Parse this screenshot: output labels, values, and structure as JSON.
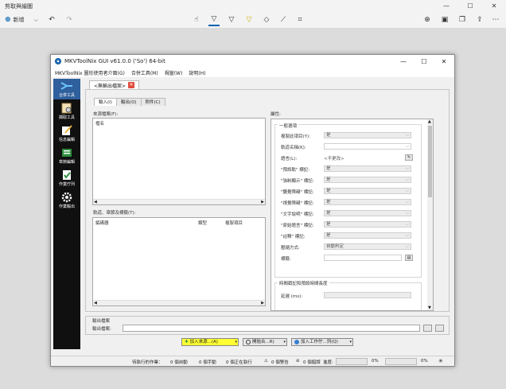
{
  "snip": {
    "title": "剪取與繪圖",
    "new_label": "新增",
    "window_controls": [
      "minimize-icon",
      "maximize-icon",
      "close-icon"
    ],
    "toolbar_icons": [
      "undo-icon",
      "redo-icon",
      "touch-writing-icon",
      "ballpoint-pen-icon",
      "pencil-icon",
      "highlighter-icon",
      "eraser-icon",
      "ruler-icon",
      "crop-icon",
      "zoom-icon",
      "save-icon",
      "copy-icon",
      "share-icon",
      "more-icon"
    ]
  },
  "mkv": {
    "title": "MKVToolNix GUI v61.0.0 ('So') 64-bit",
    "menu": [
      "MKVToolNix 圖形使用者介面(G)",
      "合併工具(M)",
      "視窗(W)",
      "說明(H)"
    ],
    "sidebar": [
      {
        "label": "合併工具",
        "icon": "merge-icon",
        "active": true
      },
      {
        "label": "擷取工具",
        "icon": "extract-icon",
        "active": false
      },
      {
        "label": "信息編輯",
        "icon": "info-editor-icon",
        "active": false
      },
      {
        "label": "章節編輯",
        "icon": "chapter-editor-icon",
        "active": false
      },
      {
        "label": "作業佇列",
        "icon": "job-queue-icon",
        "active": false
      },
      {
        "label": "作業輸出",
        "icon": "job-output-icon",
        "active": false
      }
    ],
    "outer_tab": "<無輸出檔案>",
    "sub_tabs": [
      "輸入(I)",
      "輸出(O)",
      "附件(C)"
    ],
    "source_files_label": "來源檔案(F):",
    "source_col_name": "檔名",
    "tracks_label": "軌道、章節及標籤(T):",
    "tracks_cols": [
      "編碼器",
      "類型",
      "複製項目"
    ],
    "properties_label": "屬性:",
    "general_group": "一般選項",
    "props": [
      {
        "label": "複製此項目(Y):",
        "value": "是",
        "kind": "combo"
      },
      {
        "label": "軌道名稱(K):",
        "value": "",
        "kind": "combo-white"
      },
      {
        "label": "語言(L):",
        "value": "<不更改>",
        "kind": "text-btn"
      },
      {
        "label": "\"預設軌\" 標記:",
        "value": "是",
        "kind": "combo"
      },
      {
        "label": "\"強制顯示\" 標記:",
        "value": "是",
        "kind": "combo"
      },
      {
        "label": "\"聽覺障礙\" 標記:",
        "value": "是",
        "kind": "combo"
      },
      {
        "label": "\"視覺障礙\" 標記:",
        "value": "是",
        "kind": "combo"
      },
      {
        "label": "\"文字說明\" 標記:",
        "value": "是",
        "kind": "combo"
      },
      {
        "label": "\"原始語言\" 標記:",
        "value": "是",
        "kind": "combo"
      },
      {
        "label": "\"註釋\" 標記:",
        "value": "是",
        "kind": "combo"
      },
      {
        "label": "壓縮方式:",
        "value": "自動判定",
        "kind": "combo"
      },
      {
        "label": "標籤:",
        "value": "",
        "kind": "white-btn"
      }
    ],
    "timing_group": "時間戳記和預設時間長度",
    "delay_label": "延遲 (ms):",
    "output_group": "輸出檔案",
    "output_file_label": "輸出檔案:",
    "output_file_value": "",
    "btn_add_source": "加入來源...(A)",
    "btn_start_mux": "開始合...R)",
    "btn_add_queue": "加入工作佇...列(Q)",
    "status": {
      "pending": "待執行的作業：",
      "auto": "0 個自動",
      "manual": "0 個手動",
      "running": "0 個正在執行",
      "warnings": "0 個警告",
      "errors": "0 個錯誤",
      "progress_label": "進度:",
      "pct1": "0%",
      "pct2": "0%"
    }
  }
}
